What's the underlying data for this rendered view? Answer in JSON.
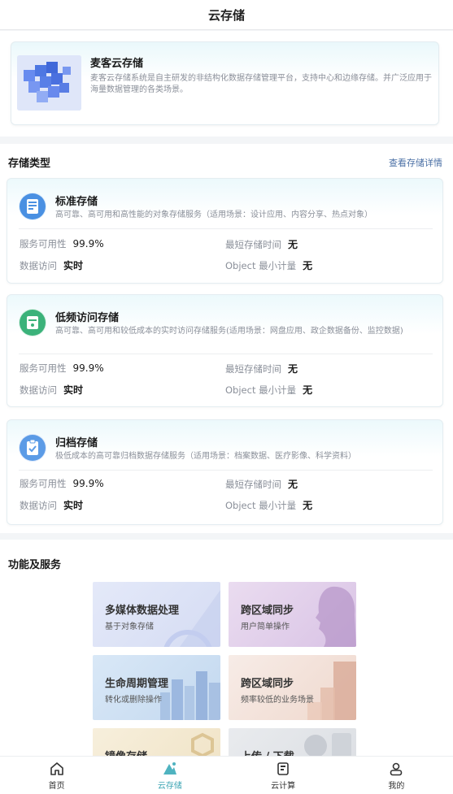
{
  "header": {
    "title": "云存储"
  },
  "intro": {
    "title": "麦客云存储",
    "desc": "麦客云存储系统是自主研发的非结构化数据存储管理平台，支持中心和边缘存储。并广泛应用于海量数据管理的各类场景。"
  },
  "storage_types": {
    "section_title": "存储类型",
    "detail_link": "查看存储详情",
    "cards": [
      {
        "title": "标准存储",
        "desc": "高可靠、高可用和高性能的对象存储服务（适用场景：设计应用、内容分享、热点对象）",
        "availability_label": "服务可用性",
        "availability_value": "99.9%",
        "min_time_label": "最短存储时间",
        "min_time_value": "无",
        "access_label": "数据访问",
        "access_value": "实时",
        "min_unit_label": "Object 最小计量",
        "min_unit_value": "无",
        "icon": "document-icon",
        "color": "#4a90e2"
      },
      {
        "title": "低频访问存储",
        "desc": "高可靠、高可用和较低成本的实时访问存储服务(适用场景：网盘应用、政企数据备份、监控数据)",
        "availability_label": "服务可用性",
        "availability_value": "99.9%",
        "min_time_label": "最短存储时间",
        "min_time_value": "无",
        "access_label": "数据访问",
        "access_value": "实时",
        "min_unit_label": "Object 最小计量",
        "min_unit_value": "无",
        "icon": "archive-box-icon",
        "color": "#3bb27a"
      },
      {
        "title": "归档存储",
        "desc": "极低成本的高可靠归档数据存储服务（适用场景：档案数据、医疗影像、科学资料）",
        "availability_label": "服务可用性",
        "availability_value": "99.9%",
        "min_time_label": "最短存储时间",
        "min_time_value": "无",
        "access_label": "数据访问",
        "access_value": "实时",
        "min_unit_label": "Object 最小计量",
        "min_unit_value": "无",
        "icon": "clipboard-icon",
        "color": "#5b9be6"
      }
    ]
  },
  "functions": {
    "section_title": "功能及服务",
    "tiles": [
      {
        "title": "多媒体数据处理",
        "sub": "基于对象存储"
      },
      {
        "title": "跨区域同步",
        "sub": "用户简单操作"
      },
      {
        "title": "生命周期管理",
        "sub": "转化或删除操作"
      },
      {
        "title": "跨区域同步",
        "sub": "频率较低的业务场景"
      },
      {
        "title": "镜像存储",
        "sub": ""
      },
      {
        "title": "上传 / 下载",
        "sub": ""
      }
    ]
  },
  "tabbar": {
    "items": [
      {
        "label": "首页",
        "icon": "home-icon"
      },
      {
        "label": "云存储",
        "icon": "cloud-storage-icon",
        "active": true
      },
      {
        "label": "云计算",
        "icon": "cloud-compute-icon"
      },
      {
        "label": "我的",
        "icon": "user-icon"
      }
    ]
  }
}
